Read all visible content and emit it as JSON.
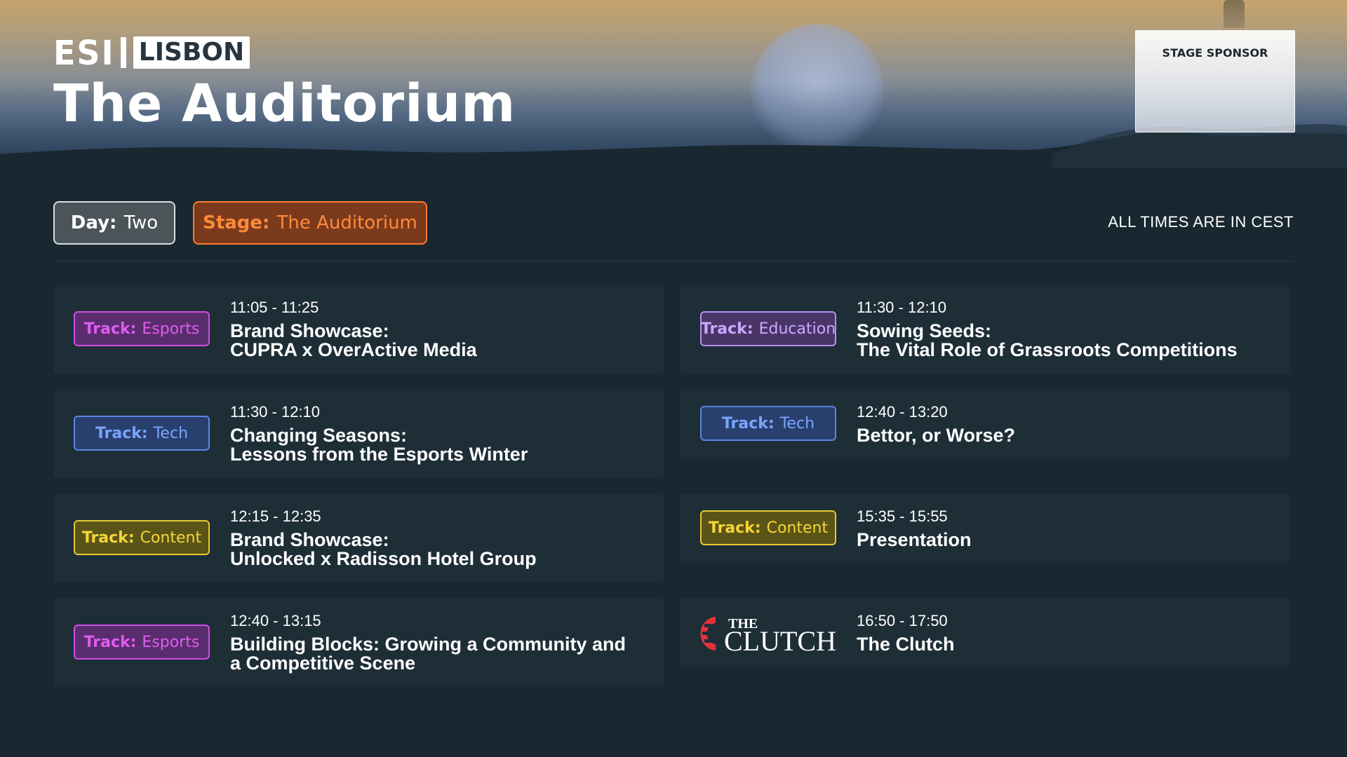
{
  "header": {
    "logo_brand": "ESI",
    "logo_city": "LISBON",
    "venue_title": "The Auditorium",
    "sponsor_label": "STAGE SPONSOR"
  },
  "filters": {
    "day_key": "Day:",
    "day_value": "Two",
    "stage_key": "Stage:",
    "stage_value": "The Auditorium",
    "timezone_note": "ALL TIMES ARE IN CEST"
  },
  "colors": {
    "background": "#192830",
    "card": "#1e2e37",
    "esports": "#e05cf0",
    "tech": "#7aa4ff",
    "content": "#f5d63a",
    "education": "#caa8ff",
    "stage_accent": "#ff8a3a"
  },
  "sessions_left": [
    {
      "track_key": "Track:",
      "track": "Esports",
      "time": "11:05 - 11:25",
      "title_line1": "Brand Showcase:",
      "title_line2": "CUPRA x OverActive Media"
    },
    {
      "track_key": "Track:",
      "track": "Tech",
      "time": "11:30 - 12:10",
      "title_line1": "Changing Seasons:",
      "title_line2": "Lessons from the Esports Winter"
    },
    {
      "track_key": "Track:",
      "track": "Content",
      "time": "12:15 - 12:35",
      "title_line1": "Brand Showcase:",
      "title_line2": "Unlocked x Radisson Hotel Group"
    },
    {
      "track_key": "Track:",
      "track": "Esports",
      "time": "12:40 - 13:15",
      "title_line1": "Building Blocks: Growing a Community and",
      "title_line2": "a Competitive Scene"
    }
  ],
  "sessions_right": [
    {
      "track_key": "Track:",
      "track": "Education",
      "time": "11:30 - 12:10",
      "title_line1": "Sowing Seeds:",
      "title_line2": "The Vital Role of Grassroots Competitions"
    },
    {
      "track_key": "Track:",
      "track": "Tech",
      "time": "12:40 - 13:20",
      "title_line1": "Bettor, or Worse?"
    },
    {
      "track_key": "Track:",
      "track": "Content",
      "time": "15:35 - 15:55",
      "title_line1": "Presentation"
    },
    {
      "logo_the": "THE",
      "logo_word": "CLUTCH",
      "time": "16:50 - 17:50",
      "title_line1": "The Clutch"
    }
  ]
}
